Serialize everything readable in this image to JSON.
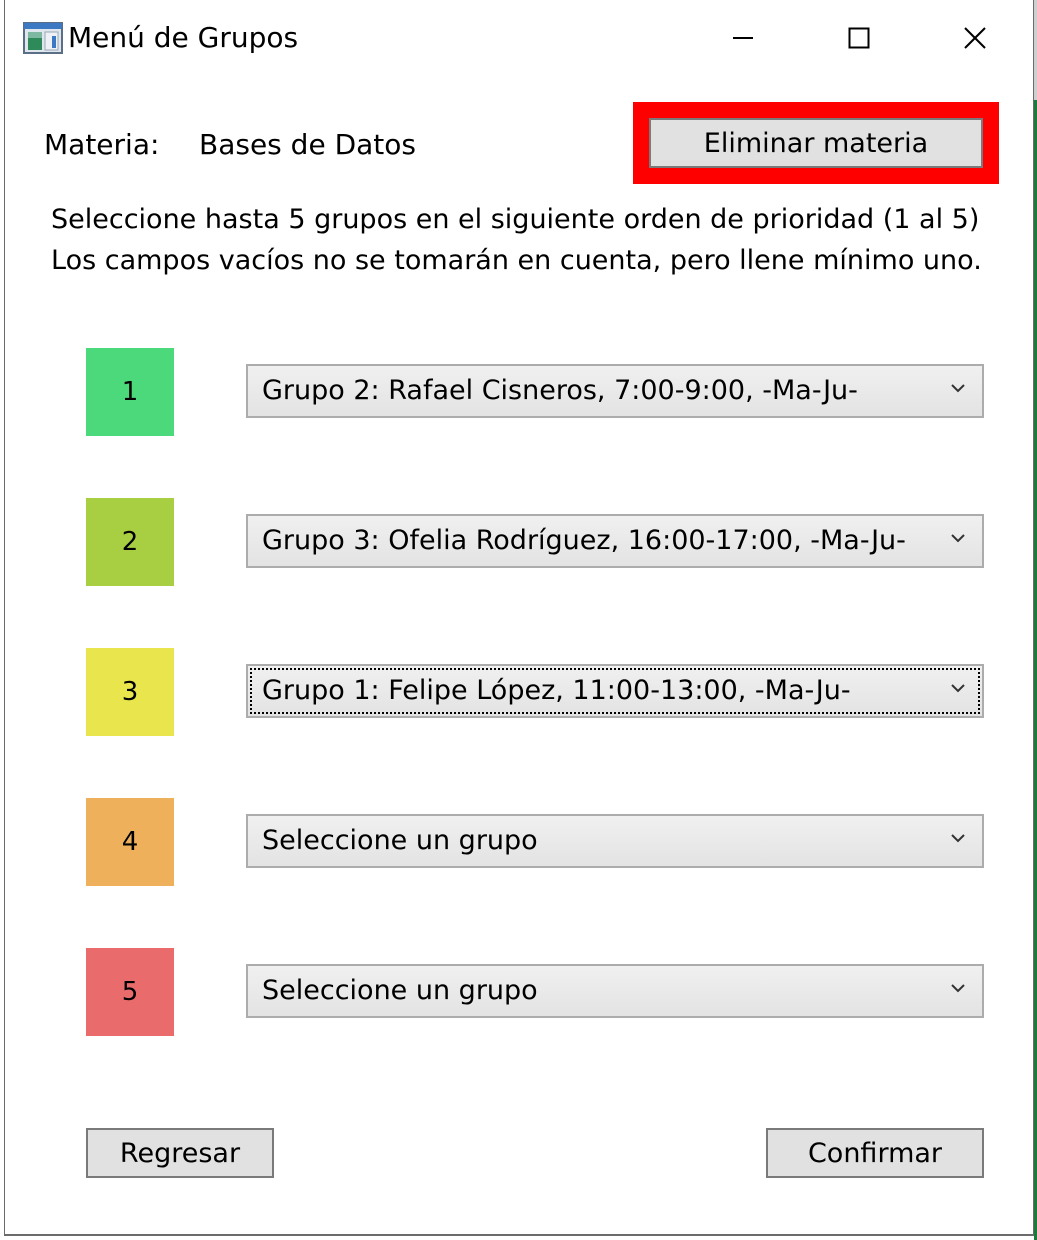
{
  "window": {
    "title": "Menú de Grupos",
    "app_icon": "form-window-icon",
    "controls": {
      "minimize": "minimize-icon",
      "maximize": "maximize-icon",
      "close": "close-icon"
    }
  },
  "materia": {
    "label": "Materia:",
    "value": "Bases de Datos"
  },
  "delete_button": {
    "label": "Eliminar materia",
    "highlight_color": "#ff0000"
  },
  "instructions": [
    "Seleccione hasta 5 grupos en el siguiente orden de prioridad (1 al 5)",
    "Los campos vacíos no se tomarán en cuenta, pero llene mínimo uno."
  ],
  "priorities": [
    {
      "number": "1",
      "color": "#4cd97c",
      "selected": "Grupo 2: Rafael Cisneros, 7:00-9:00, -Ma-Ju-"
    },
    {
      "number": "2",
      "color": "#a8cf42",
      "selected": "Grupo 3: Ofelia Rodríguez, 16:00-17:00, -Ma-Ju-"
    },
    {
      "number": "3",
      "color": "#e8e64c",
      "selected": "Grupo 1: Felipe López, 11:00-13:00, -Ma-Ju-"
    },
    {
      "number": "4",
      "color": "#eeb05a",
      "selected": "Seleccione un grupo"
    },
    {
      "number": "5",
      "color": "#ea6b6b",
      "selected": "Seleccione un grupo"
    }
  ],
  "footer": {
    "back_label": "Regresar",
    "confirm_label": "Confirmar"
  }
}
